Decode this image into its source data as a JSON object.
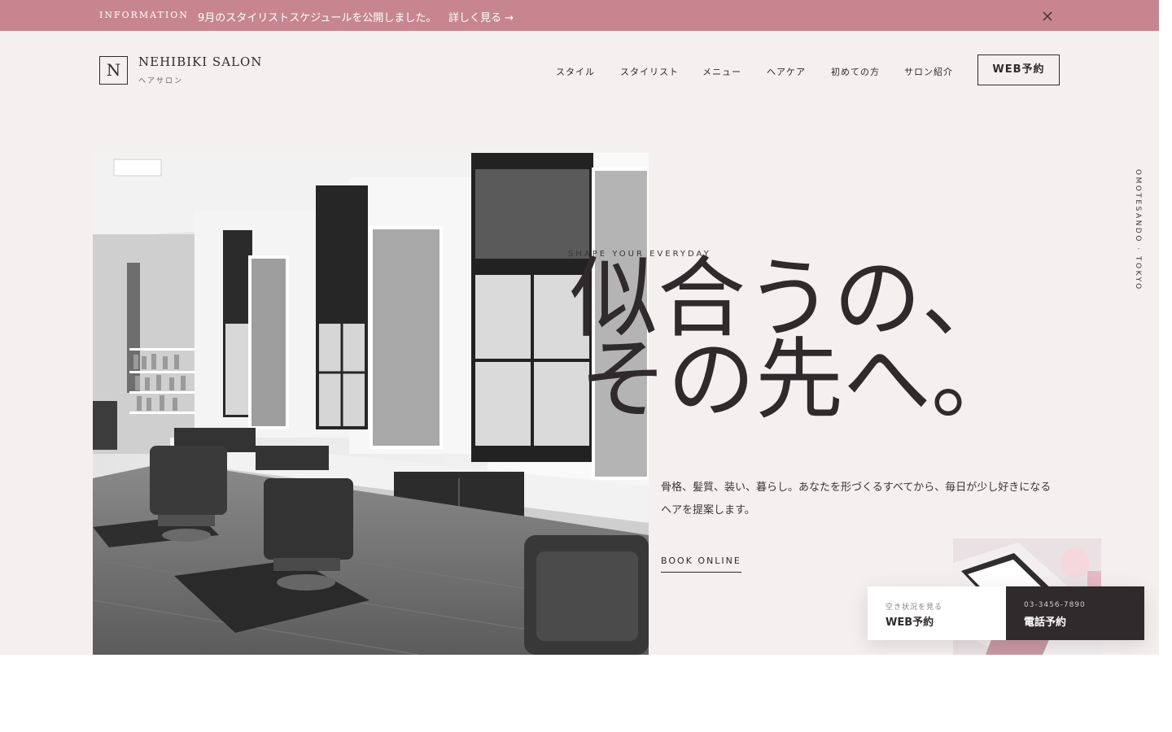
{
  "info_bar": {
    "label": "INFORMATION",
    "message": "9月のスタイリストスケジュールを公開しました。",
    "link": "詳しく見る →",
    "close_icon": "close-icon"
  },
  "header": {
    "logo_letter": "N",
    "brand": "NEHIBIKI SALON",
    "brand_sub": "ヘアサロン",
    "nav": [
      "スタイル",
      "スタイリスト",
      "メニュー",
      "ヘアケア",
      "初めての方",
      "サロン紹介"
    ],
    "reserve_button": "WEB予約"
  },
  "hero": {
    "tagline": "SHAPE YOUR EVERYDAY",
    "headline_line1": "似合うの、",
    "headline_line2": "その先へ。",
    "lead": "骨格、髪質、装い、暮らし。あなたを形づくるすべてから、毎日が少し好きになるヘアを提案します。",
    "book_link": "BOOK ONLINE",
    "vertical_text": "OMOTESANDO · TOKYO"
  },
  "cta": {
    "web_small": "空き状況を見る",
    "web_big": "WEB予約",
    "tel_small": "03-3456-7890",
    "tel_big": "電話予約"
  },
  "colors": {
    "accent": "#c7868f",
    "background": "#f4f0ef",
    "dark": "#2f2a2c"
  }
}
